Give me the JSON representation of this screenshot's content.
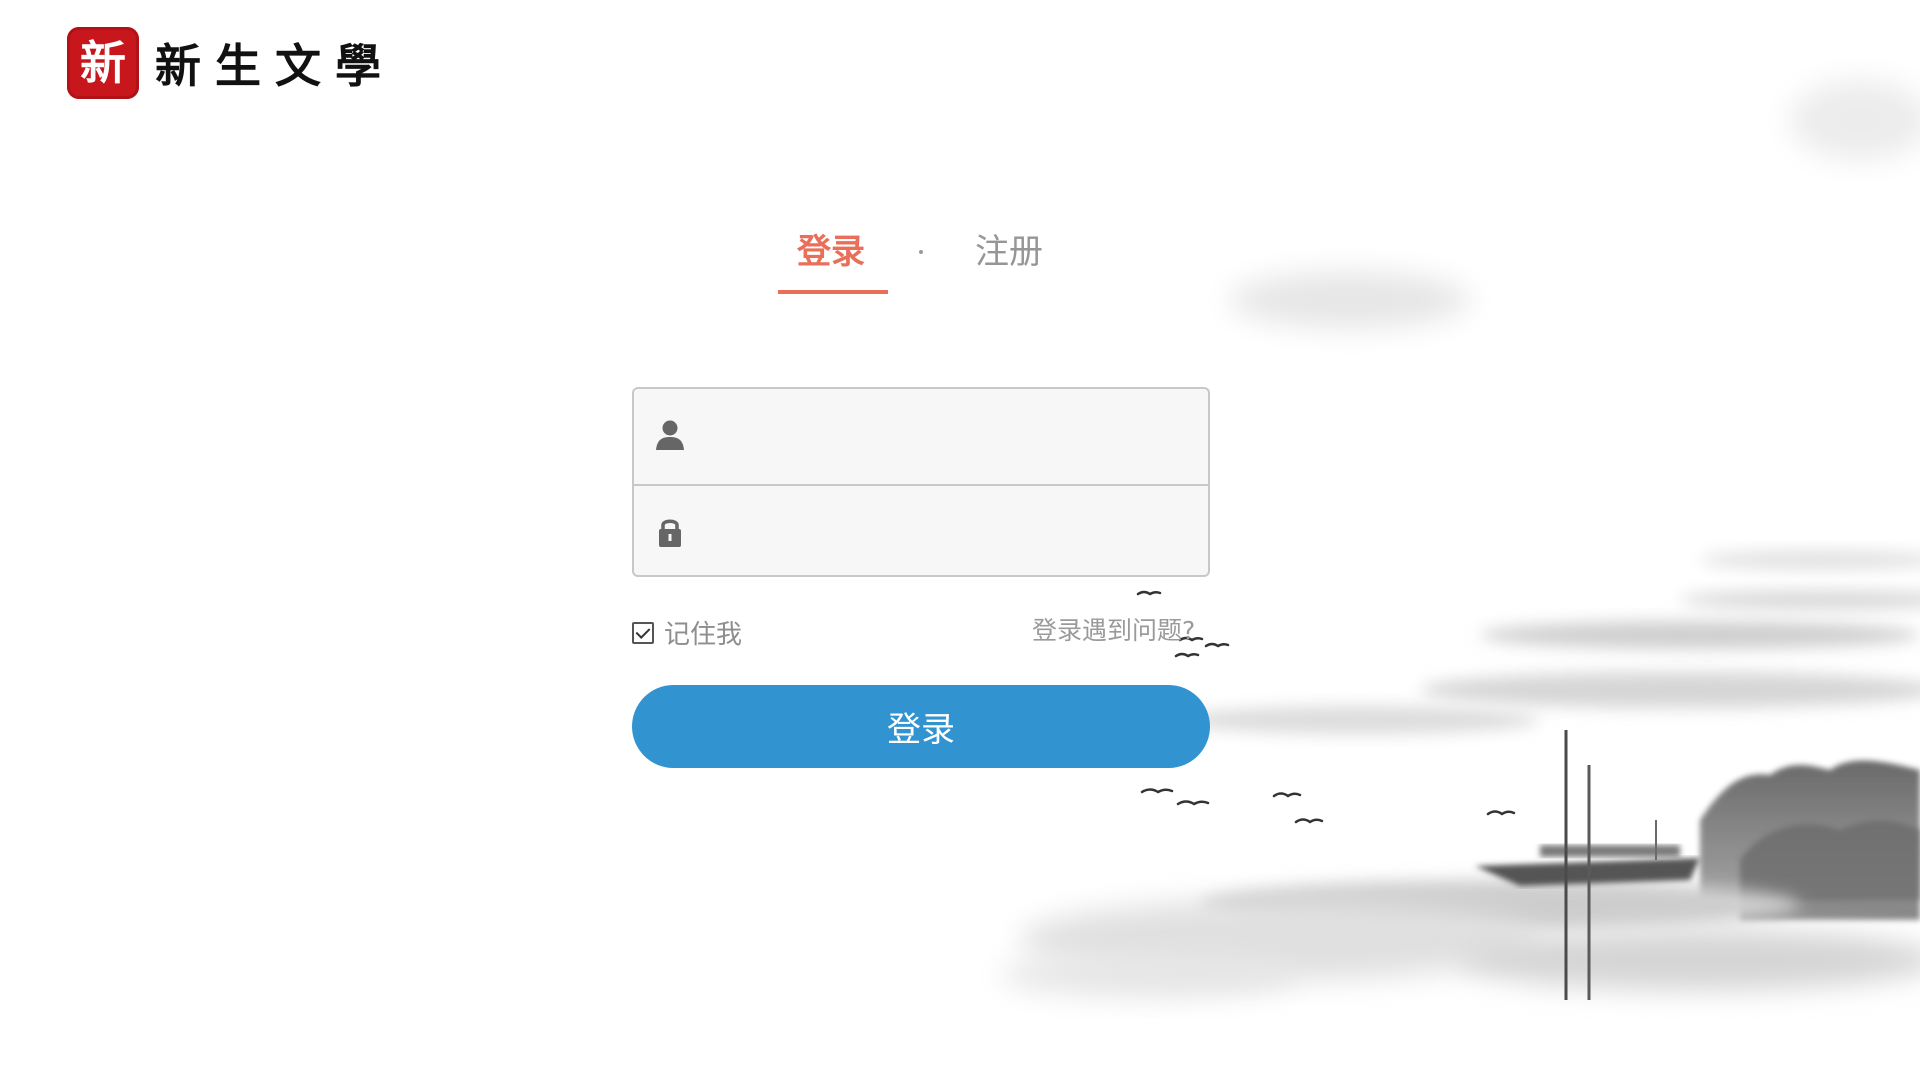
{
  "brand": {
    "seal_text": "新",
    "title": "新生文學"
  },
  "tabs": {
    "login_label": "登录",
    "separator": "·",
    "register_label": "注册",
    "active": "login",
    "active_color": "#ea6f5a"
  },
  "form": {
    "username": {
      "icon": "user-icon",
      "value": "",
      "placeholder": ""
    },
    "password": {
      "icon": "lock-icon",
      "value": "",
      "placeholder": ""
    },
    "remember_me": {
      "label": "记住我",
      "checked": true
    },
    "help_link": "登录遇到问题?",
    "submit_label": "登录",
    "submit_color": "#3194d0"
  }
}
